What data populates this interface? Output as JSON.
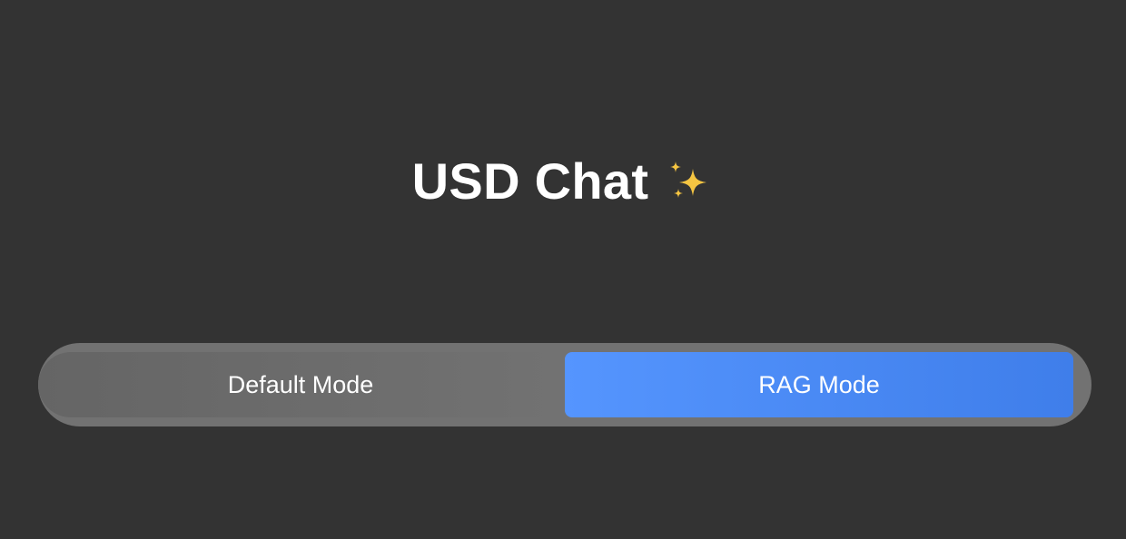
{
  "header": {
    "title": "USD Chat",
    "title_icon": "sparkles-icon"
  },
  "mode_toggle": {
    "options": [
      {
        "label": "Default Mode",
        "selected": false
      },
      {
        "label": "RAG Mode",
        "selected": true
      }
    ]
  },
  "colors": {
    "background": "#333333",
    "toggle_track": "#727272",
    "accent": "#4a8cf7",
    "sparkle": "#f5c542"
  }
}
